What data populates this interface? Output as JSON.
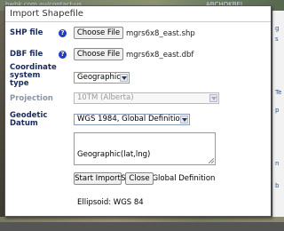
{
  "background": {
    "link_text": "hwbk.com.au/contact-us",
    "caps_text": "ABCHOKBEI",
    "right_fragments": [
      "g",
      "s",
      "Te",
      "p",
      "n",
      "b"
    ]
  },
  "dialog": {
    "title": "Import Shapefile",
    "shp": {
      "label": "SHP file",
      "button": "Choose File",
      "filename": "mgrs6x8_east.shp"
    },
    "dbf": {
      "label": "DBF file",
      "button": "Choose File",
      "filename": "mgrs6x8_east.dbf"
    },
    "coord": {
      "label_lines": [
        "Coordinate",
        "system",
        "type"
      ],
      "value": "Geographic"
    },
    "projection": {
      "label": "Projection",
      "value": "10TM (Alberta)"
    },
    "datum": {
      "label_lines": [
        "Geodetic",
        "Datum"
      ],
      "value": "WGS 1984, Global Definition"
    },
    "info_lines": [
      "Geographic(lat,lng)",
      "Datum: WGS 1984, Global Definition",
      "Ellipsoid: WGS 84"
    ],
    "buttons": {
      "start_import": "Start Import",
      "close": "Close"
    },
    "help_glyph": "?"
  },
  "colors": {
    "label": "#1a2a5a",
    "help_icon": "#1f3fbf",
    "disabled": "#999999"
  }
}
